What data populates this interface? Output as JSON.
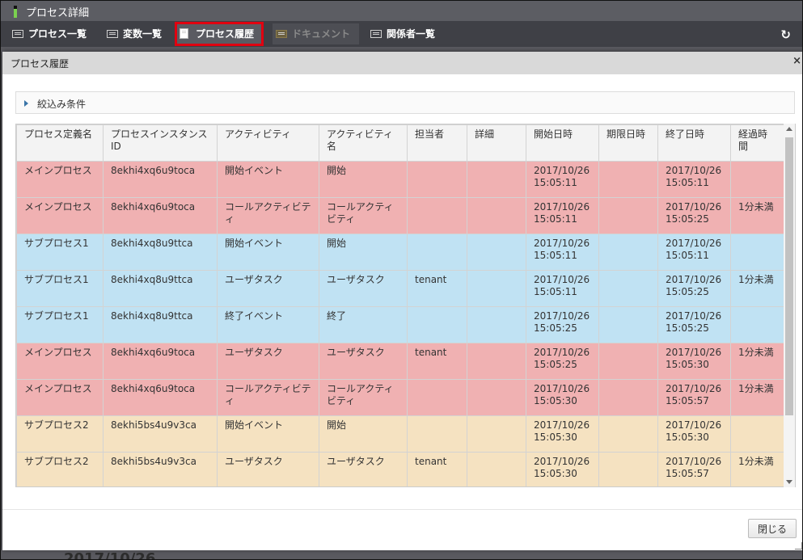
{
  "window": {
    "title": "プロセス詳細"
  },
  "toolbar": {
    "tabs": [
      {
        "label": "プロセス一覧",
        "state": "normal"
      },
      {
        "label": "変数一覧",
        "state": "normal"
      },
      {
        "label": "プロセス履歴",
        "state": "active"
      },
      {
        "label": "ドキュメント",
        "state": "disabled"
      },
      {
        "label": "関係者一覧",
        "state": "normal"
      }
    ],
    "refresh_icon": "refresh-icon"
  },
  "background": {
    "partial_text": "2017/10/26"
  },
  "dialog": {
    "title": "プロセス履歴",
    "close_glyph": "×",
    "filter_label": "絞込み条件",
    "close_button": "閉じる",
    "columns": [
      "プロセス定義名",
      "プロセスインスタンスID",
      "アクティビティ",
      "アクティビティ名",
      "担当者",
      "詳細",
      "開始日時",
      "期限日時",
      "終了日時",
      "経過時間"
    ],
    "rows": [
      {
        "color": "pink",
        "cells": [
          "メインプロセス",
          "8ekhi4xq6u9toca",
          "開始イベント",
          "開始",
          "",
          "",
          "2017/10/26 15:05:11",
          "",
          "2017/10/26 15:05:11",
          ""
        ]
      },
      {
        "color": "pink",
        "cells": [
          "メインプロセス",
          "8ekhi4xq6u9toca",
          "コールアクティビティ",
          "コールアクティビティ",
          "",
          "",
          "2017/10/26 15:05:11",
          "",
          "2017/10/26 15:05:25",
          "1分未満"
        ]
      },
      {
        "color": "blue",
        "cells": [
          "サブプロセス1",
          "8ekhi4xq8u9ttca",
          "開始イベント",
          "開始",
          "",
          "",
          "2017/10/26 15:05:11",
          "",
          "2017/10/26 15:05:11",
          ""
        ]
      },
      {
        "color": "blue",
        "cells": [
          "サブプロセス1",
          "8ekhi4xq8u9ttca",
          "ユーザタスク",
          "ユーザタスク",
          "tenant",
          "",
          "2017/10/26 15:05:11",
          "",
          "2017/10/26 15:05:25",
          "1分未満"
        ]
      },
      {
        "color": "blue",
        "cells": [
          "サブプロセス1",
          "8ekhi4xq8u9ttca",
          "終了イベント",
          "終了",
          "",
          "",
          "2017/10/26 15:05:25",
          "",
          "2017/10/26 15:05:25",
          ""
        ]
      },
      {
        "color": "pink",
        "cells": [
          "メインプロセス",
          "8ekhi4xq6u9toca",
          "ユーザタスク",
          "ユーザタスク",
          "tenant",
          "",
          "2017/10/26 15:05:25",
          "",
          "2017/10/26 15:05:30",
          "1分未満"
        ]
      },
      {
        "color": "pink",
        "cells": [
          "メインプロセス",
          "8ekhi4xq6u9toca",
          "コールアクティビティ",
          "コールアクティビティ",
          "",
          "",
          "2017/10/26 15:05:30",
          "",
          "2017/10/26 15:05:57",
          "1分未満"
        ]
      },
      {
        "color": "yellow",
        "cells": [
          "サブプロセス2",
          "8ekhi5bs4u9v3ca",
          "開始イベント",
          "開始",
          "",
          "",
          "2017/10/26 15:05:30",
          "",
          "2017/10/26 15:05:30",
          ""
        ]
      },
      {
        "color": "yellow",
        "cells": [
          "サブプロセス2",
          "8ekhi5bs4u9v3ca",
          "ユーザタスク",
          "ユーザタスク",
          "tenant",
          "",
          "2017/10/26 15:05:30",
          "",
          "2017/10/26 15:05:57",
          "1分未満"
        ]
      }
    ]
  },
  "colors": {
    "pink": "#f0b1b2",
    "blue": "#c0e2f3",
    "yellow": "#f5e2c1",
    "active_outline": "#e10010"
  }
}
